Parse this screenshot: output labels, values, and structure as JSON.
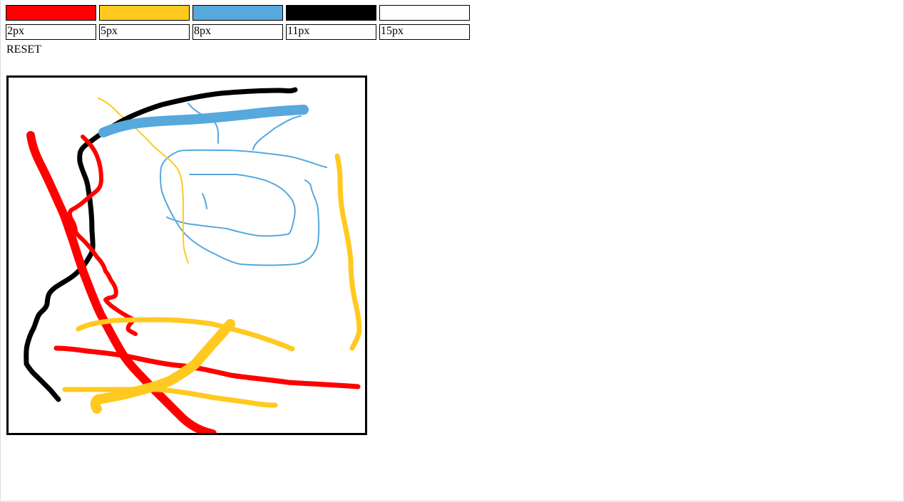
{
  "palette": {
    "colors": [
      {
        "name": "red",
        "hex": "#ff0000"
      },
      {
        "name": "yellow",
        "hex": "#ffc91f"
      },
      {
        "name": "blue",
        "hex": "#56a8dd"
      },
      {
        "name": "black",
        "hex": "#000000"
      },
      {
        "name": "white",
        "hex": "#ffffff"
      }
    ]
  },
  "brush_sizes": [
    "2px",
    "5px",
    "8px",
    "11px",
    "15px"
  ],
  "reset_label": "RESET"
}
